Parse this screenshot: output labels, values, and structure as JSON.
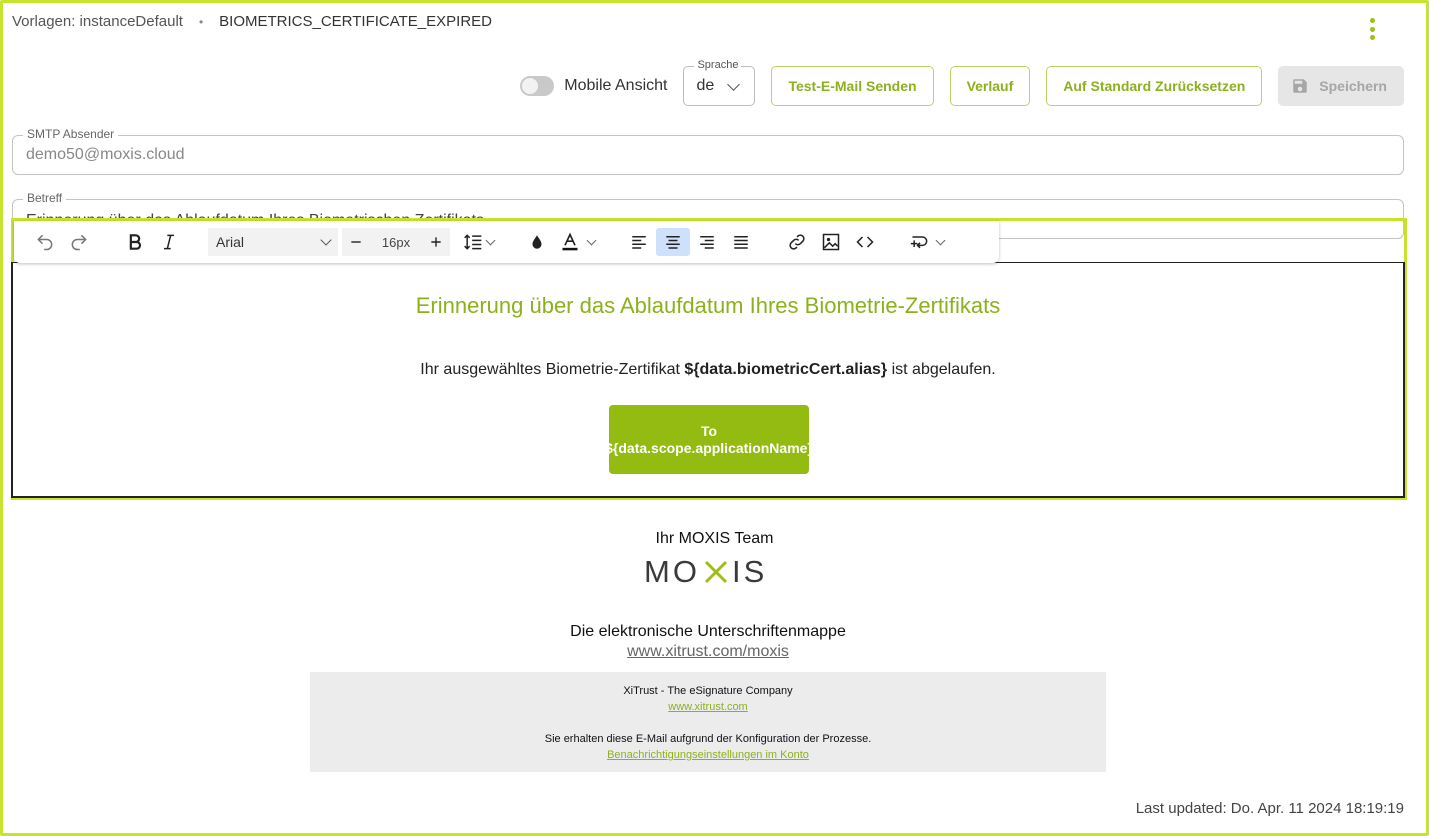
{
  "breadcrumb": {
    "root": "Vorlagen: instanceDefault",
    "separator": "•",
    "current": "BIOMETRICS_CERTIFICATE_EXPIRED"
  },
  "header_actions": {
    "menu_icon": "more-vertical-icon",
    "mobile_toggle": {
      "label": "Mobile Ansicht",
      "checked": false
    },
    "language": {
      "legend": "Sprache",
      "value": "de"
    },
    "test_email_label": "Test-E-Mail Senden",
    "history_label": "Verlauf",
    "reset_label": "Auf Standard Zurücksetzen",
    "save_label": "Speichern",
    "save_disabled": true
  },
  "form": {
    "smtp": {
      "legend": "SMTP Absender",
      "value": "demo50@moxis.cloud"
    },
    "subject": {
      "legend": "Betreff",
      "value": "Erinnerung über das Ablaufdatum Ihres Biometrischen Zertifikats"
    }
  },
  "editor_toolbar": {
    "font_family": "Arial",
    "font_size": "16px",
    "active_alignment": "center"
  },
  "email": {
    "title": "Erinnerung über das Ablaufdatum Ihres Biometrie-Zertifikats",
    "message_before": "Ihr ausgewähltes Biometrie-Zertifikat ",
    "message_var": "${data.biometricCert.alias}",
    "message_after": " ist abgelaufen.",
    "cta_label": "To ${data.scope.applicationName}",
    "signoff": "Ihr MOXIS Team",
    "logo_text": "MOXIS",
    "tagline": "Die elektronische Unterschriftenmappe",
    "website": "www.xitrust.com/moxis",
    "footer": {
      "company": "XiTrust - The eSignature Company",
      "company_link": "www.xitrust.com",
      "notice": "Sie erhalten diese E-Mail aufgrund der Konfiguration der Prozesse.",
      "settings_link": "Benachrichtigungseinstellungen im Konto"
    }
  },
  "last_updated": "Last updated: Do. Apr. 11 2024 18:19:19",
  "colors": {
    "accent": "#94bb11",
    "focus_outline": "#c5e42e",
    "heading": "#8cb11c"
  }
}
